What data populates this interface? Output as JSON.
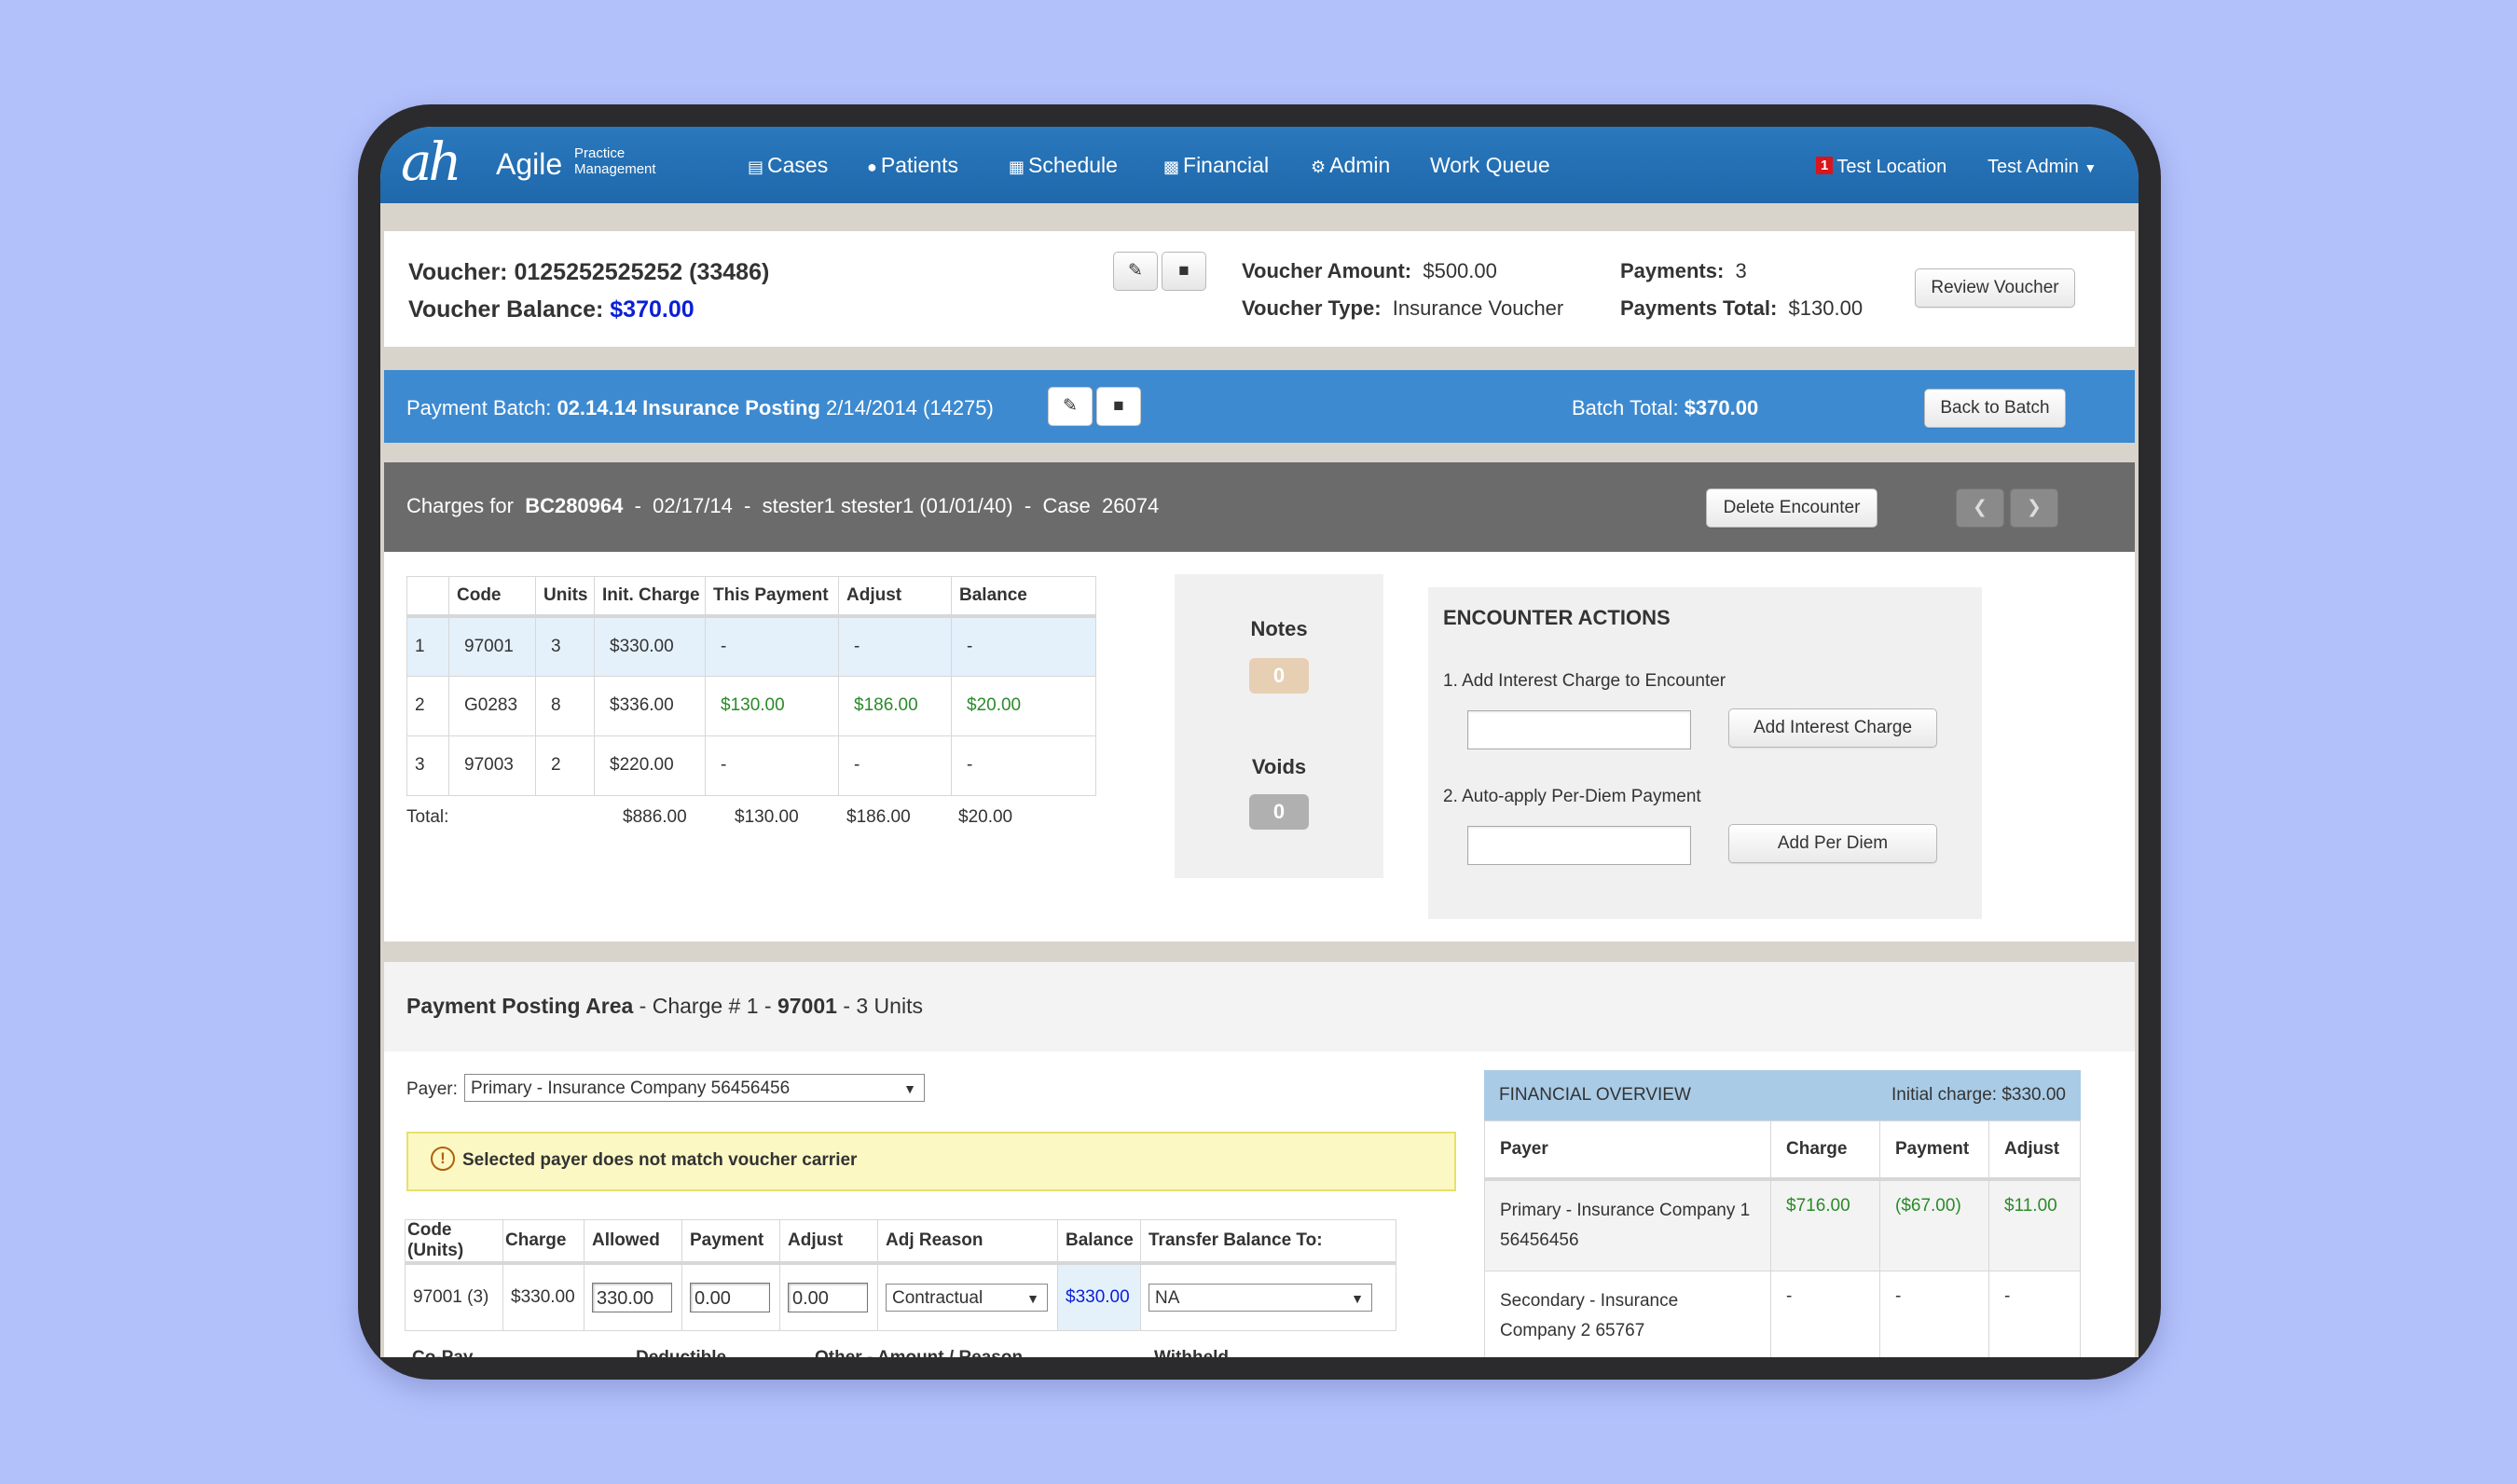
{
  "nav": {
    "logo_mark": "ah",
    "logo_name": "Agile",
    "logo_sub_1": "Practice",
    "logo_sub_2": "Management",
    "items": [
      {
        "label": "Cases",
        "icon": "list-icon"
      },
      {
        "label": "Patients",
        "icon": "user-icon"
      },
      {
        "label": "Schedule",
        "icon": "calendar-icon"
      },
      {
        "label": "Financial",
        "icon": "chart-icon"
      },
      {
        "label": "Admin",
        "icon": "gears-icon"
      },
      {
        "label": "Work Queue",
        "icon": ""
      }
    ],
    "notification_count": "1",
    "location": "Test Location",
    "user": "Test Admin"
  },
  "voucher": {
    "label": "Voucher:",
    "number": "0125252525252 (33486)",
    "balance_label": "Voucher Balance:",
    "balance": "$370.00",
    "amount_label": "Voucher Amount:",
    "amount": "$500.00",
    "type_label": "Voucher Type:",
    "type": "Insurance Voucher",
    "payments_label": "Payments:",
    "payments": "3",
    "payments_total_label": "Payments Total:",
    "payments_total": "$130.00",
    "review_button": "Review Voucher"
  },
  "batch": {
    "label": "Payment Batch:",
    "name": "02.14.14 Insurance Posting",
    "date_id": "2/14/2014 (14275)",
    "total_label": "Batch Total:",
    "total": "$370.00",
    "back_button": "Back to Batch"
  },
  "encounter": {
    "charges_for": "Charges for",
    "id": "BC280964",
    "sep1": "-",
    "date": "02/17/14",
    "sep2": "-",
    "patient": "stester1 stester1 (01/01/40)",
    "sep3": "-",
    "case_label": "Case",
    "case_number": "26074",
    "delete_button": "Delete Encounter"
  },
  "charges": {
    "headers": [
      "",
      "Code",
      "Units",
      "Init. Charge",
      "This Payment",
      "Adjust",
      "Balance"
    ],
    "rows": [
      [
        "1",
        "97001",
        "3",
        "$330.00",
        "-",
        "-",
        "-"
      ],
      [
        "2",
        "G0283",
        "8",
        "$336.00",
        "$130.00",
        "$186.00",
        "$20.00"
      ],
      [
        "3",
        "97003",
        "2",
        "$220.00",
        "-",
        "-",
        "-"
      ]
    ],
    "total_label": "Total:",
    "totals": [
      "$886.00",
      "$130.00",
      "$186.00",
      "$20.00"
    ]
  },
  "notes": {
    "label": "Notes",
    "count": "0"
  },
  "voids": {
    "label": "Voids",
    "count": "0"
  },
  "encounter_actions": {
    "title": "ENCOUNTER ACTIONS",
    "action1": "1. Add Interest Charge to Encounter",
    "action1_button": "Add Interest Charge",
    "action2": "2. Auto-apply Per-Diem Payment",
    "action2_button": "Add Per Diem"
  },
  "posting": {
    "title": "Payment Posting Area",
    "charge_part": "- Charge # 1 -",
    "code": "97001",
    "units_part": "- 3 Units",
    "payer_label": "Payer:",
    "payer_value": "Primary - Insurance Company 56456456",
    "warning": "Selected payer does not match voucher carrier",
    "headers": [
      "Code (Units)",
      "Charge",
      "Allowed",
      "Payment",
      "Adjust",
      "Adj Reason",
      "Balance",
      "Transfer Balance To:"
    ],
    "row": {
      "code_units": "97001 (3)",
      "charge": "$330.00",
      "allowed": "330.00",
      "payment": "0.00",
      "adjust": "0.00",
      "adj_reason": "Contractual",
      "balance": "$330.00",
      "transfer": "NA"
    },
    "sub_labels": [
      "Co-Pay",
      "Deductible",
      "Other - Amount / Reason",
      "Withheld"
    ]
  },
  "financial_overview": {
    "title": "FINANCIAL OVERVIEW",
    "initial_charge": "Initial charge: $330.00",
    "headers": [
      "Payer",
      "Charge",
      "Payment",
      "Adjust"
    ],
    "rows": [
      {
        "payer_1": "Primary - Insurance Company 1",
        "payer_2": "56456456",
        "charge": "$716.00",
        "payment": "($67.00)",
        "adjust": "$11.00"
      },
      {
        "payer_1": "Secondary - Insurance",
        "payer_2": "Company 2 65767",
        "charge": "-",
        "payment": "-",
        "adjust": "-"
      }
    ]
  }
}
